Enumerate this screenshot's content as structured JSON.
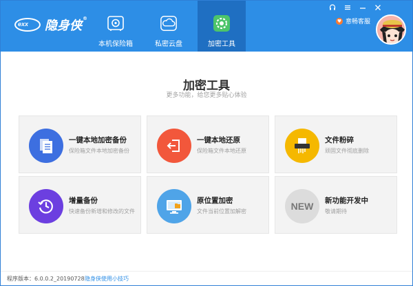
{
  "app": {
    "name": "隐身侠",
    "logo_mark": "exx",
    "logo_reg": "®"
  },
  "nav": {
    "items": [
      {
        "label": "本机保险箱",
        "icon": "safe-icon"
      },
      {
        "label": "私密云盘",
        "icon": "cloud-icon"
      },
      {
        "label": "加密工具",
        "icon": "gear-tool-icon",
        "active": true
      }
    ]
  },
  "header": {
    "service_label": "意畅客服"
  },
  "main": {
    "title": "加密工具",
    "subtitle": "更多功能，给您更多贴心体验",
    "tools": [
      {
        "title": "一键本地加密备份",
        "desc": "保险箱文件本地加密备份",
        "icon": "document-copy-icon",
        "color": "#3d6fe0"
      },
      {
        "title": "一键本地还原",
        "desc": "保险箱文件本地还原",
        "icon": "restore-icon",
        "color": "#f2573b"
      },
      {
        "title": "文件粉碎",
        "desc": "顽固文件彻底删除",
        "icon": "shredder-icon",
        "color": "#f5b800"
      },
      {
        "title": "增量备份",
        "desc": "快速备份新增和修改的文件",
        "icon": "clock-backup-icon",
        "color": "#6c3fe0"
      },
      {
        "title": "原位置加密",
        "desc": "文件当前位置加解密",
        "icon": "monitor-folder-icon",
        "color": "#4fa4e8"
      },
      {
        "title": "新功能开发中",
        "desc": "敬请期待",
        "icon": "new-badge-icon",
        "color": "#dcdcdc",
        "badge": "NEW"
      }
    ]
  },
  "footer": {
    "version": "程序版本：6.0.0.2_20190728",
    "tips": "隐身侠使用小技巧"
  }
}
